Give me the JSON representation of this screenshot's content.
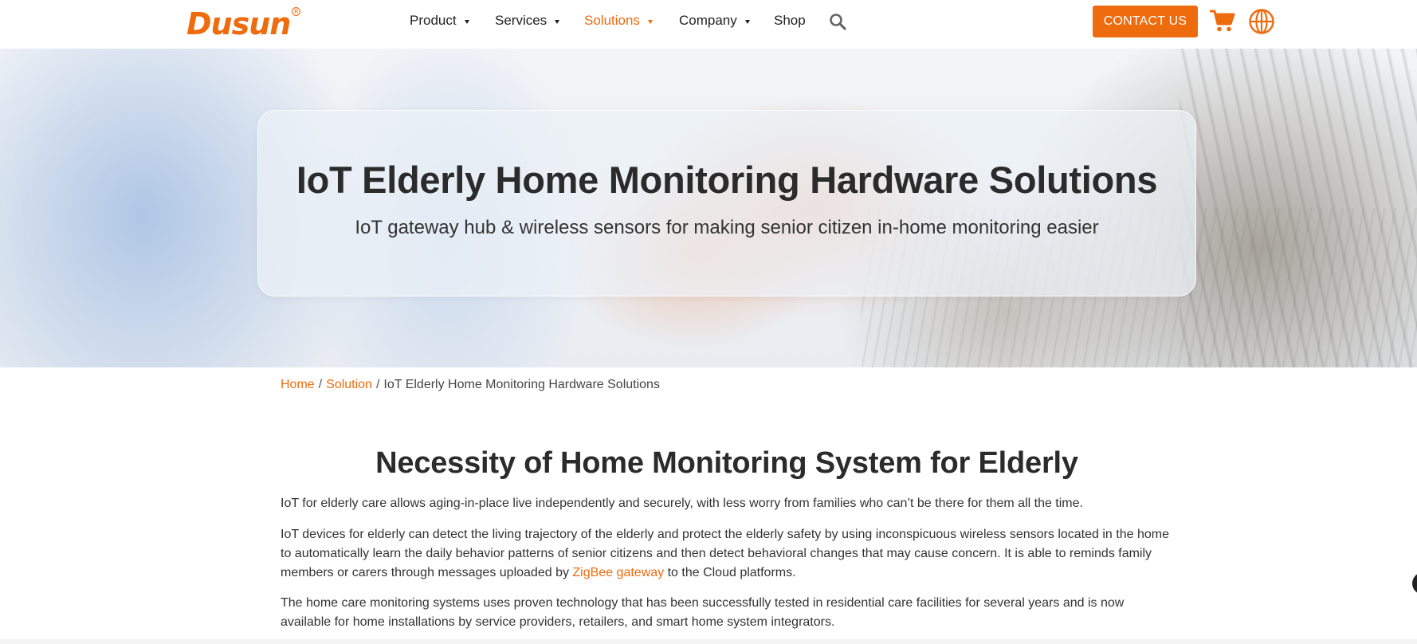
{
  "brand": {
    "name": "Dusun",
    "reg_mark": "R",
    "accent_color": "#ee6b0e"
  },
  "nav": {
    "items": [
      {
        "label": "Product",
        "has_dropdown": true,
        "active": false
      },
      {
        "label": "Services",
        "has_dropdown": true,
        "active": false
      },
      {
        "label": "Solutions",
        "has_dropdown": true,
        "active": true
      },
      {
        "label": "Company",
        "has_dropdown": true,
        "active": false
      },
      {
        "label": "Shop",
        "has_dropdown": false,
        "active": false
      }
    ],
    "search_icon": "search-icon",
    "contact_label": "CONTACT US",
    "cart_icon": "cart-icon",
    "language_icon": "globe-icon"
  },
  "hero": {
    "title": "IoT Elderly Home Monitoring Hardware Solutions",
    "subtitle": "IoT gateway hub & wireless sensors for making senior citizen in-home monitoring easier"
  },
  "breadcrumb": {
    "home": "Home",
    "separator": "/",
    "section": "Solution",
    "current": "IoT Elderly Home Monitoring Hardware Solutions"
  },
  "content": {
    "title": "Necessity of Home Monitoring System for Elderly",
    "p1": "IoT for elderly care allows aging-in-place live independently and securely, with less worry from families who can’t be there for them all the time.",
    "p2_before": "IoT devices for elderly can detect the living trajectory of the elderly and protect the elderly safety by using inconspicuous wireless sensors located in the home to automatically learn the daily behavior patterns of senior citizens and then detect behavioral changes that may cause concern. It is able to reminds family members or carers through messages uploaded by ",
    "p2_link": "ZigBee gateway",
    "p2_after": " to the Cloud platforms.",
    "p3": "The home care monitoring systems uses proven technology that has been successfully tested in residential care facilities for several years and is now available for home installations by service providers, retailers, and smart home system integrators."
  }
}
